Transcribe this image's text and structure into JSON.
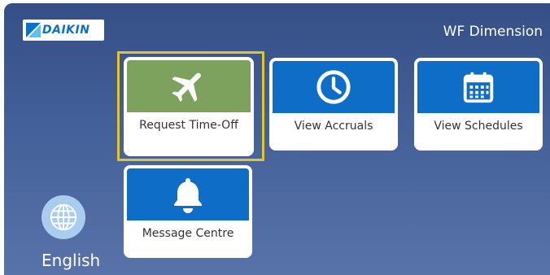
{
  "brand": {
    "logo_text": "DAIKIN",
    "title": "WF Dimension"
  },
  "tiles": [
    {
      "label": "Request Time-Off",
      "icon": "airplane-icon",
      "band_color": "#7da25d",
      "selected": true
    },
    {
      "label": "View Accruals",
      "icon": "clock-icon",
      "band_color": "#0e6dc6"
    },
    {
      "label": "View Schedules",
      "icon": "calendar-icon",
      "band_color": "#0e6dc6"
    },
    {
      "label": "Message Centre",
      "icon": "bell-icon",
      "band_color": "#0e6dc6"
    }
  ],
  "language": {
    "label": "English",
    "icon": "globe-icon"
  },
  "colors": {
    "background": "#44609a",
    "selection": "#e2c526",
    "accent": "#0e6dc6"
  }
}
